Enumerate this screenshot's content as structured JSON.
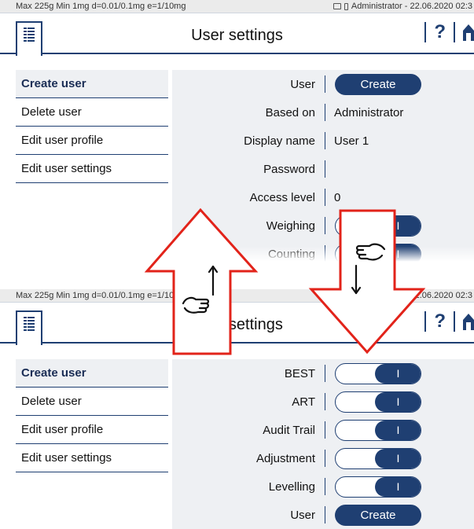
{
  "status_bar": {
    "left": "Max 225g  Min 1mg  d=0.01/0.1mg  e=1/10mg",
    "right": "Administrator - 22.06.2020 02:3"
  },
  "header": {
    "title": "User settings",
    "help": "?"
  },
  "sidebar": {
    "items": [
      {
        "label": "Create user"
      },
      {
        "label": "Delete user"
      },
      {
        "label": "Edit user profile"
      },
      {
        "label": "Edit user settings"
      }
    ]
  },
  "top_rows": [
    {
      "label": "User",
      "create_label": "Create"
    },
    {
      "label": "Based on",
      "value": "Administrator"
    },
    {
      "label": "Display name",
      "value": "User 1"
    },
    {
      "label": "Password",
      "value": ""
    },
    {
      "label": "Access level",
      "value": "0"
    },
    {
      "label": "Weighing",
      "off": "0",
      "on": "I"
    },
    {
      "label": "Counting",
      "off": "0",
      "on": "I"
    }
  ],
  "bottom_rows": [
    {
      "label": "BEST",
      "off": "0",
      "on": "I"
    },
    {
      "label": "ART",
      "off": "0",
      "on": "I"
    },
    {
      "label": "Audit Trail",
      "off": "0",
      "on": "I"
    },
    {
      "label": "Adjustment",
      "off": "0",
      "on": "I"
    },
    {
      "label": "Levelling",
      "off": "0",
      "on": "I"
    },
    {
      "label": "User",
      "create_label": "Create"
    }
  ],
  "colors": {
    "accent": "#1f3f72",
    "row_bg": "#eef0f3",
    "arrow": "#e2231a",
    "status_bg": "#ebebeb"
  },
  "icons": [
    "list-icon",
    "help-icon",
    "home-icon",
    "swipe-up-hand-icon",
    "swipe-down-hand-icon"
  ]
}
